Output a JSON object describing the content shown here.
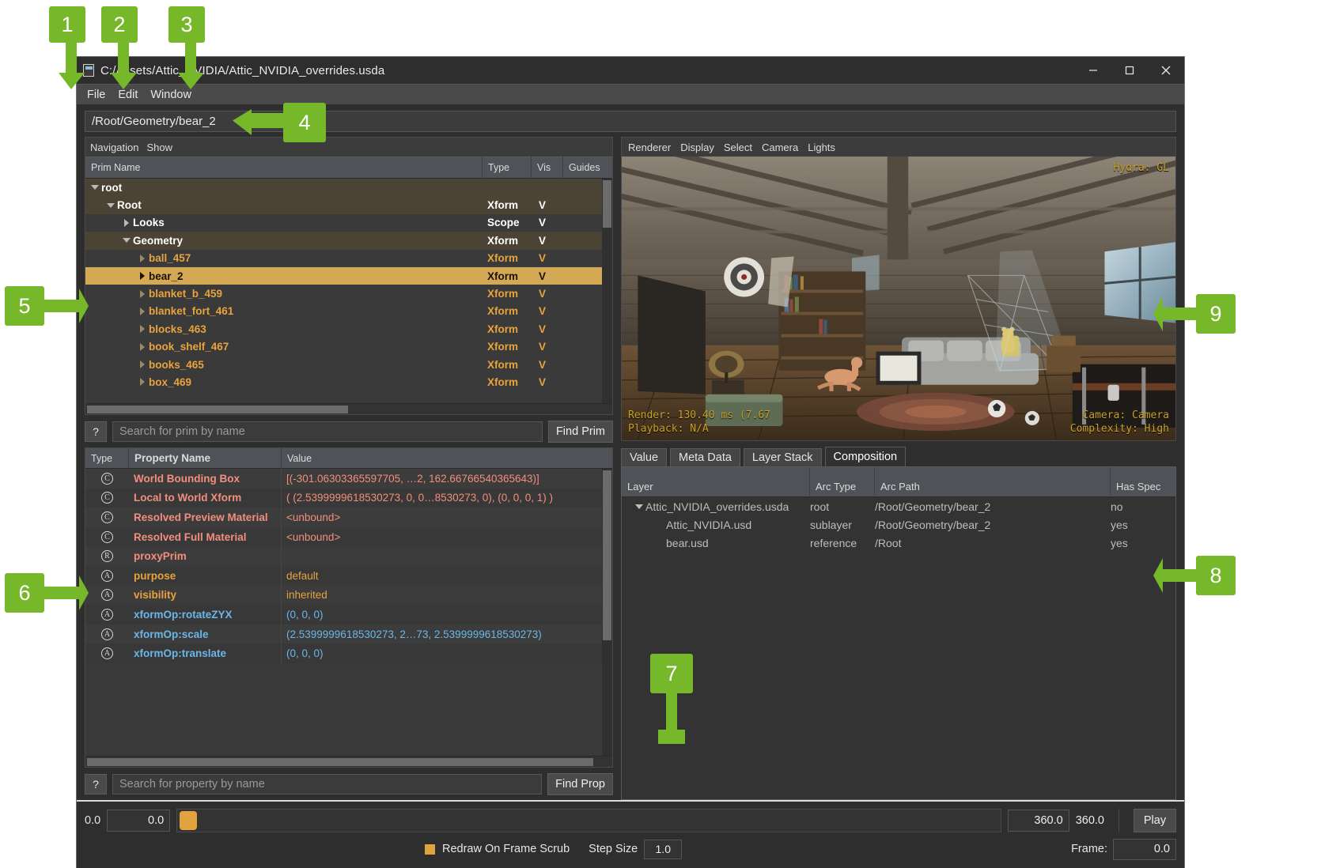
{
  "window": {
    "title": "C:/Assets/Attic_NVIDIA/Attic_NVIDIA_overrides.usda",
    "minimize": "─",
    "maximize": "□",
    "close": "✕"
  },
  "menubar": {
    "items": [
      "File",
      "Edit",
      "Window"
    ]
  },
  "pathbar": {
    "value": "/Root/Geometry/bear_2"
  },
  "tree": {
    "menu": [
      "Navigation",
      "Show"
    ],
    "columns": [
      "Prim Name",
      "Type",
      "Vis",
      "Guides"
    ],
    "rows": [
      {
        "name": "root",
        "type": "",
        "vis": "",
        "indent": 0,
        "expander": "down",
        "color": "#ffffff",
        "selected": false,
        "alt": true
      },
      {
        "name": "Root",
        "type": "Xform",
        "vis": "V",
        "indent": 1,
        "expander": "down",
        "color": "#ffffff",
        "selected": false,
        "alt": true
      },
      {
        "name": "Looks",
        "type": "Scope",
        "vis": "V",
        "indent": 2,
        "expander": "right",
        "color": "#ffffff",
        "selected": false,
        "alt": false
      },
      {
        "name": "Geometry",
        "type": "Xform",
        "vis": "V",
        "indent": 2,
        "expander": "down",
        "color": "#ffffff",
        "selected": false,
        "alt": true
      },
      {
        "name": "ball_457",
        "type": "Xform",
        "vis": "V",
        "indent": 3,
        "expander": "right",
        "color": "#e8a33d",
        "selected": false,
        "alt": false
      },
      {
        "name": "bear_2",
        "type": "Xform",
        "vis": "V",
        "indent": 3,
        "expander": "right",
        "color": "#000000",
        "selected": true,
        "alt": false
      },
      {
        "name": "blanket_b_459",
        "type": "Xform",
        "vis": "V",
        "indent": 3,
        "expander": "right",
        "color": "#e8a33d",
        "selected": false,
        "alt": false
      },
      {
        "name": "blanket_fort_461",
        "type": "Xform",
        "vis": "V",
        "indent": 3,
        "expander": "right",
        "color": "#e8a33d",
        "selected": false,
        "alt": false
      },
      {
        "name": "blocks_463",
        "type": "Xform",
        "vis": "V",
        "indent": 3,
        "expander": "right",
        "color": "#e8a33d",
        "selected": false,
        "alt": false
      },
      {
        "name": "book_shelf_467",
        "type": "Xform",
        "vis": "V",
        "indent": 3,
        "expander": "right",
        "color": "#e8a33d",
        "selected": false,
        "alt": false
      },
      {
        "name": "books_465",
        "type": "Xform",
        "vis": "V",
        "indent": 3,
        "expander": "right",
        "color": "#e8a33d",
        "selected": false,
        "alt": false
      },
      {
        "name": "box_469",
        "type": "Xform",
        "vis": "V",
        "indent": 3,
        "expander": "right",
        "color": "#e8a33d",
        "selected": false,
        "alt": false
      }
    ]
  },
  "prim_search": {
    "help": "?",
    "placeholder": "Search for prim by name",
    "value": "",
    "button": "Find Prim"
  },
  "properties": {
    "columns": [
      "Type",
      "Property Name",
      "Value"
    ],
    "rows": [
      {
        "icon": "C",
        "name": "World Bounding Box",
        "value": "[(-301.06303365597705, …2, 162.66766540365643)]",
        "color": "#f28e7d"
      },
      {
        "icon": "C",
        "name": "Local to World Xform",
        "value": "( (2.5399999618530273, 0, 0…8530273, 0), (0, 0, 0, 1) )",
        "color": "#f28e7d"
      },
      {
        "icon": "C",
        "name": "Resolved Preview Material",
        "value": "<unbound>",
        "color": "#f28e7d"
      },
      {
        "icon": "C",
        "name": "Resolved Full Material",
        "value": "<unbound>",
        "color": "#f28e7d"
      },
      {
        "icon": "R",
        "name": "proxyPrim",
        "value": "",
        "color": "#f28e7d"
      },
      {
        "icon": "A",
        "name": "purpose",
        "value": "default",
        "color": "#e8a33d"
      },
      {
        "icon": "A",
        "name": "visibility",
        "value": "inherited",
        "color": "#e8a33d"
      },
      {
        "icon": "A",
        "name": "xformOp:rotateZYX",
        "value": "(0, 0, 0)",
        "color": "#6ab7e8"
      },
      {
        "icon": "A",
        "name": "xformOp:scale",
        "value": "(2.5399999618530273, 2…73, 2.5399999618530273)",
        "color": "#6ab7e8"
      },
      {
        "icon": "A",
        "name": "xformOp:translate",
        "value": "(0, 0, 0)",
        "color": "#6ab7e8"
      }
    ]
  },
  "prop_search": {
    "help": "?",
    "placeholder": "Search for property by name",
    "value": "",
    "button": "Find Prop"
  },
  "viewport": {
    "menu": [
      "Renderer",
      "Display",
      "Select",
      "Camera",
      "Lights"
    ],
    "hud_top_right": "Hydra: GL",
    "hud_bottom_left": "Render: 130.40 ms (7.67\nPlayback: N/A",
    "hud_bottom_right": "Camera: Camera\nComplexity: High"
  },
  "inspector": {
    "tabs": [
      "Value",
      "Meta Data",
      "Layer Stack",
      "Composition"
    ],
    "active_tab": "Composition",
    "columns": [
      "Layer",
      "Arc Type",
      "Arc Path",
      "Has Spec"
    ],
    "rows": [
      {
        "layer": "Attic_NVIDIA_overrides.usda",
        "arc_type": "root",
        "arc_path": "/Root/Geometry/bear_2",
        "has_spec": "no",
        "indent": 0,
        "expander": "down"
      },
      {
        "layer": "Attic_NVIDIA.usd",
        "arc_type": "sublayer",
        "arc_path": "/Root/Geometry/bear_2",
        "has_spec": "yes",
        "indent": 1,
        "expander": "none"
      },
      {
        "layer": "bear.usd",
        "arc_type": "reference",
        "arc_path": "/Root",
        "has_spec": "yes",
        "indent": 1,
        "expander": "none"
      }
    ]
  },
  "timeline": {
    "start_label": "0.0",
    "start_value": "0.0",
    "end_value": "360.0",
    "end_label": "360.0",
    "play_label": "Play",
    "redraw_label": "Redraw On Frame Scrub",
    "step_size_label": "Step Size",
    "step_size_value": "1.0",
    "frame_label": "Frame:",
    "frame_value": "0.0"
  },
  "callouts": [
    {
      "n": "1"
    },
    {
      "n": "2"
    },
    {
      "n": "3"
    },
    {
      "n": "4"
    },
    {
      "n": "5"
    },
    {
      "n": "6"
    },
    {
      "n": "7"
    },
    {
      "n": "8"
    },
    {
      "n": "9"
    }
  ],
  "colors": {
    "accent_green": "#76b82a",
    "selection": "#d4a956",
    "prim_orange": "#e8a33d",
    "prop_red": "#f28e7d",
    "prop_blue": "#6ab7e8",
    "handle_orange": "#e0a33e"
  }
}
